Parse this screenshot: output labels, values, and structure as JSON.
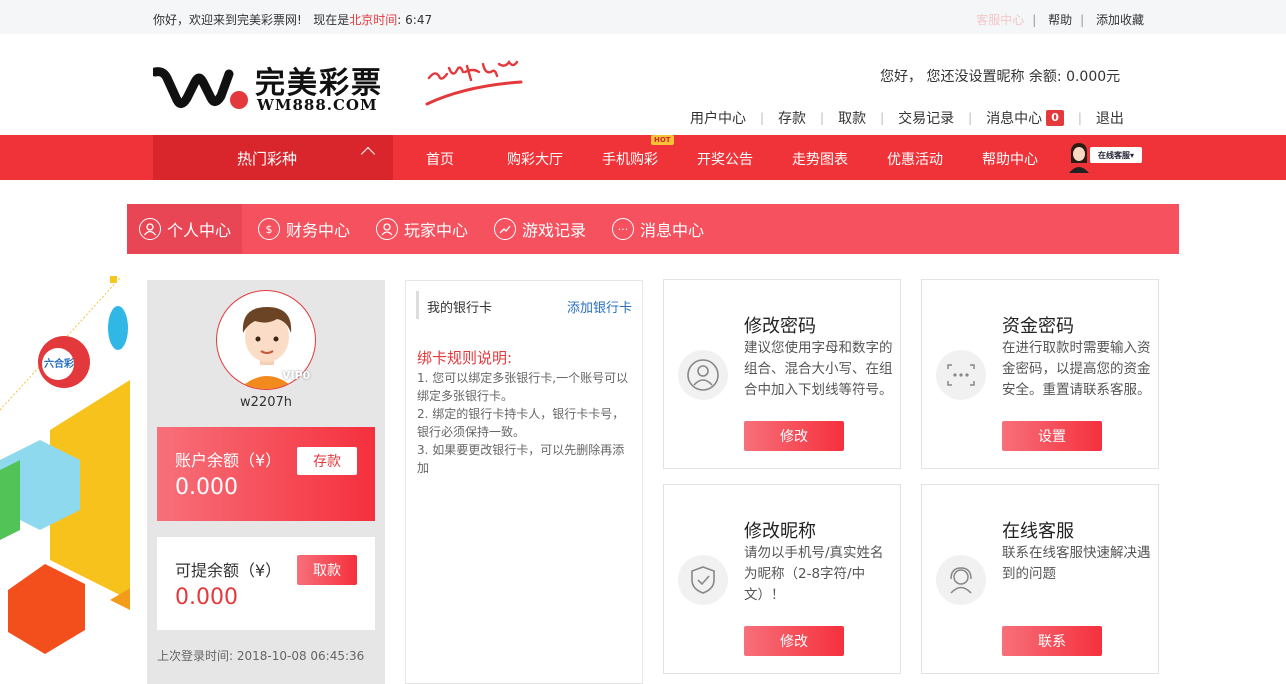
{
  "topbar": {
    "welcome": "你好，欢迎来到完美彩票网!",
    "time_prefix": "现在是",
    "time_zone": "北京时间",
    "time_colon": ":",
    "time_value": "6:47",
    "links": [
      "客服中心",
      "帮助",
      "添加收藏"
    ]
  },
  "header": {
    "logo_cn": "完美彩票",
    "logo_en": "WM888.COM",
    "greeting": "您好，  您还没设置昵称  余额: 0.000元",
    "links": [
      "用户中心",
      "存款",
      "取款",
      "交易记录",
      "消息中心",
      "退出"
    ],
    "message_count": "0"
  },
  "nav": {
    "hot_label": "热门彩种",
    "items": [
      "首页",
      "购彩大厅",
      "手机购彩",
      "开奖公告",
      "走势图表",
      "优惠活动",
      "帮助中心"
    ],
    "hot_badge": "HOT",
    "service_label": "在线客服"
  },
  "subnav": {
    "tabs": [
      {
        "label": "个人中心",
        "icon": "user-icon"
      },
      {
        "label": "财务中心",
        "icon": "money-icon"
      },
      {
        "label": "玩家中心",
        "icon": "player-icon"
      },
      {
        "label": "游戏记录",
        "icon": "chart-icon"
      },
      {
        "label": "消息中心",
        "icon": "message-icon"
      }
    ]
  },
  "deco": {
    "badge": "六合彩"
  },
  "profile": {
    "vip": "VIP0",
    "username": "w2207h",
    "balance_label": "账户余额（¥）",
    "balance_value": "0.000",
    "deposit_btn": "存款",
    "withdrawable_label": "可提余额（¥）",
    "withdrawable_value": "0.000",
    "withdraw_btn": "取款",
    "last_login": "上次登录时间: 2018-10-08 06:45:36"
  },
  "bank": {
    "title": "我的银行卡",
    "add_link": "添加银行卡",
    "rules_title": "绑卡规则说明:",
    "rules": [
      "1. 您可以绑定多张银行卡,一个账号可以绑定多张银行卡。",
      "2. 绑定的银行卡持卡人，银行卡卡号，银行必须保持一致。",
      "3. 如果要更改银行卡，可以先删除再添加"
    ]
  },
  "features": [
    {
      "title": "修改密码",
      "desc": "建议您使用字母和数字的组合、混合大小写、在组合中加入下划线等符号。",
      "button": "修改",
      "icon": "user-circle-icon"
    },
    {
      "title": "资金密码",
      "desc": "在进行取款时需要输入资金密码，以提高您的资金安全。重置请联系客服。",
      "button": "设置",
      "icon": "password-dots-icon"
    },
    {
      "title": "修改昵称",
      "desc": "请勿以手机号/真实姓名为昵称（2-8字符/中文）！",
      "button": "修改",
      "icon": "shield-check-icon"
    },
    {
      "title": "在线客服",
      "desc": "联系在线客服快速解决遇到的问题",
      "button": "联系",
      "icon": "headset-icon"
    }
  ],
  "colors": {
    "brand_red": "#f03339",
    "subnav_pink": "#f5515f",
    "link_blue": "#2a6fc0"
  }
}
